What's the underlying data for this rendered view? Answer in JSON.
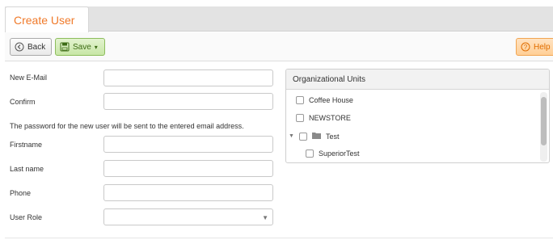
{
  "tabs": [
    {
      "label": "Create User",
      "active": true
    }
  ],
  "toolbar": {
    "back_label": "Back",
    "save_label": "Save",
    "save_caret": "▾",
    "help_label": "Help",
    "icons": {
      "back": "back-circle-icon",
      "save": "floppy-disk-icon",
      "help": "question-circle-icon"
    }
  },
  "form": {
    "new_email_label": "New E-Mail",
    "confirm_label": "Confirm",
    "note": "The password for the new user will be sent to the entered email address.",
    "firstname_label": "Firstname",
    "lastname_label": "Last name",
    "phone_label": "Phone",
    "user_role_label": "User Role",
    "values": {
      "new_email": "",
      "confirm": "",
      "firstname": "",
      "lastname": "",
      "phone": "",
      "user_role": ""
    }
  },
  "org_units": {
    "title": "Organizational Units",
    "items": [
      {
        "label": "Coffee House",
        "checked": false,
        "level": 0,
        "expandable": false
      },
      {
        "label": "NEWSTORE",
        "checked": false,
        "level": 0,
        "expandable": false
      },
      {
        "label": "Test",
        "checked": false,
        "level": 0,
        "expandable": true,
        "expanded": true,
        "icon": "folder-icon"
      },
      {
        "label": "SuperiorTest",
        "checked": false,
        "level": 1,
        "expandable": false
      }
    ]
  },
  "colors": {
    "accent": "#f07a2a",
    "save_green": "#3d6b16",
    "help_orange": "#e06d00"
  }
}
